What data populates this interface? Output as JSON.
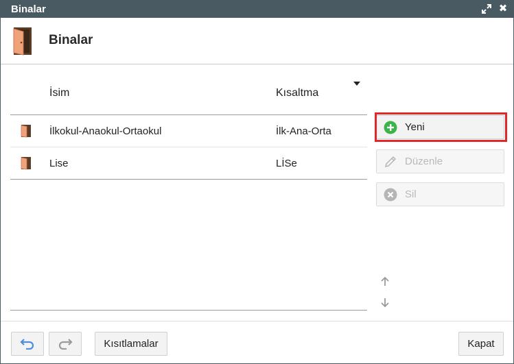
{
  "window": {
    "title": "Binalar"
  },
  "header": {
    "title": "Binalar",
    "icon": "door-icon"
  },
  "grid": {
    "columns": {
      "name": "İsim",
      "abbr": "Kısaltma"
    },
    "rows": [
      {
        "name": "İlkokul-Anaokul-Ortaokul",
        "abbr": "İlk-Ana-Orta"
      },
      {
        "name": "Lise",
        "abbr": "LİSe"
      }
    ]
  },
  "actions": {
    "new_label": "Yeni",
    "edit_label": "Düzenle",
    "delete_label": "Sil"
  },
  "footer": {
    "restrictions_label": "Kısıtlamalar",
    "close_label": "Kapat"
  },
  "colors": {
    "titlebar": "#4a5a63",
    "highlight": "#e02828",
    "new_icon": "#3cb44a",
    "undo_icon": "#4a90d9"
  }
}
